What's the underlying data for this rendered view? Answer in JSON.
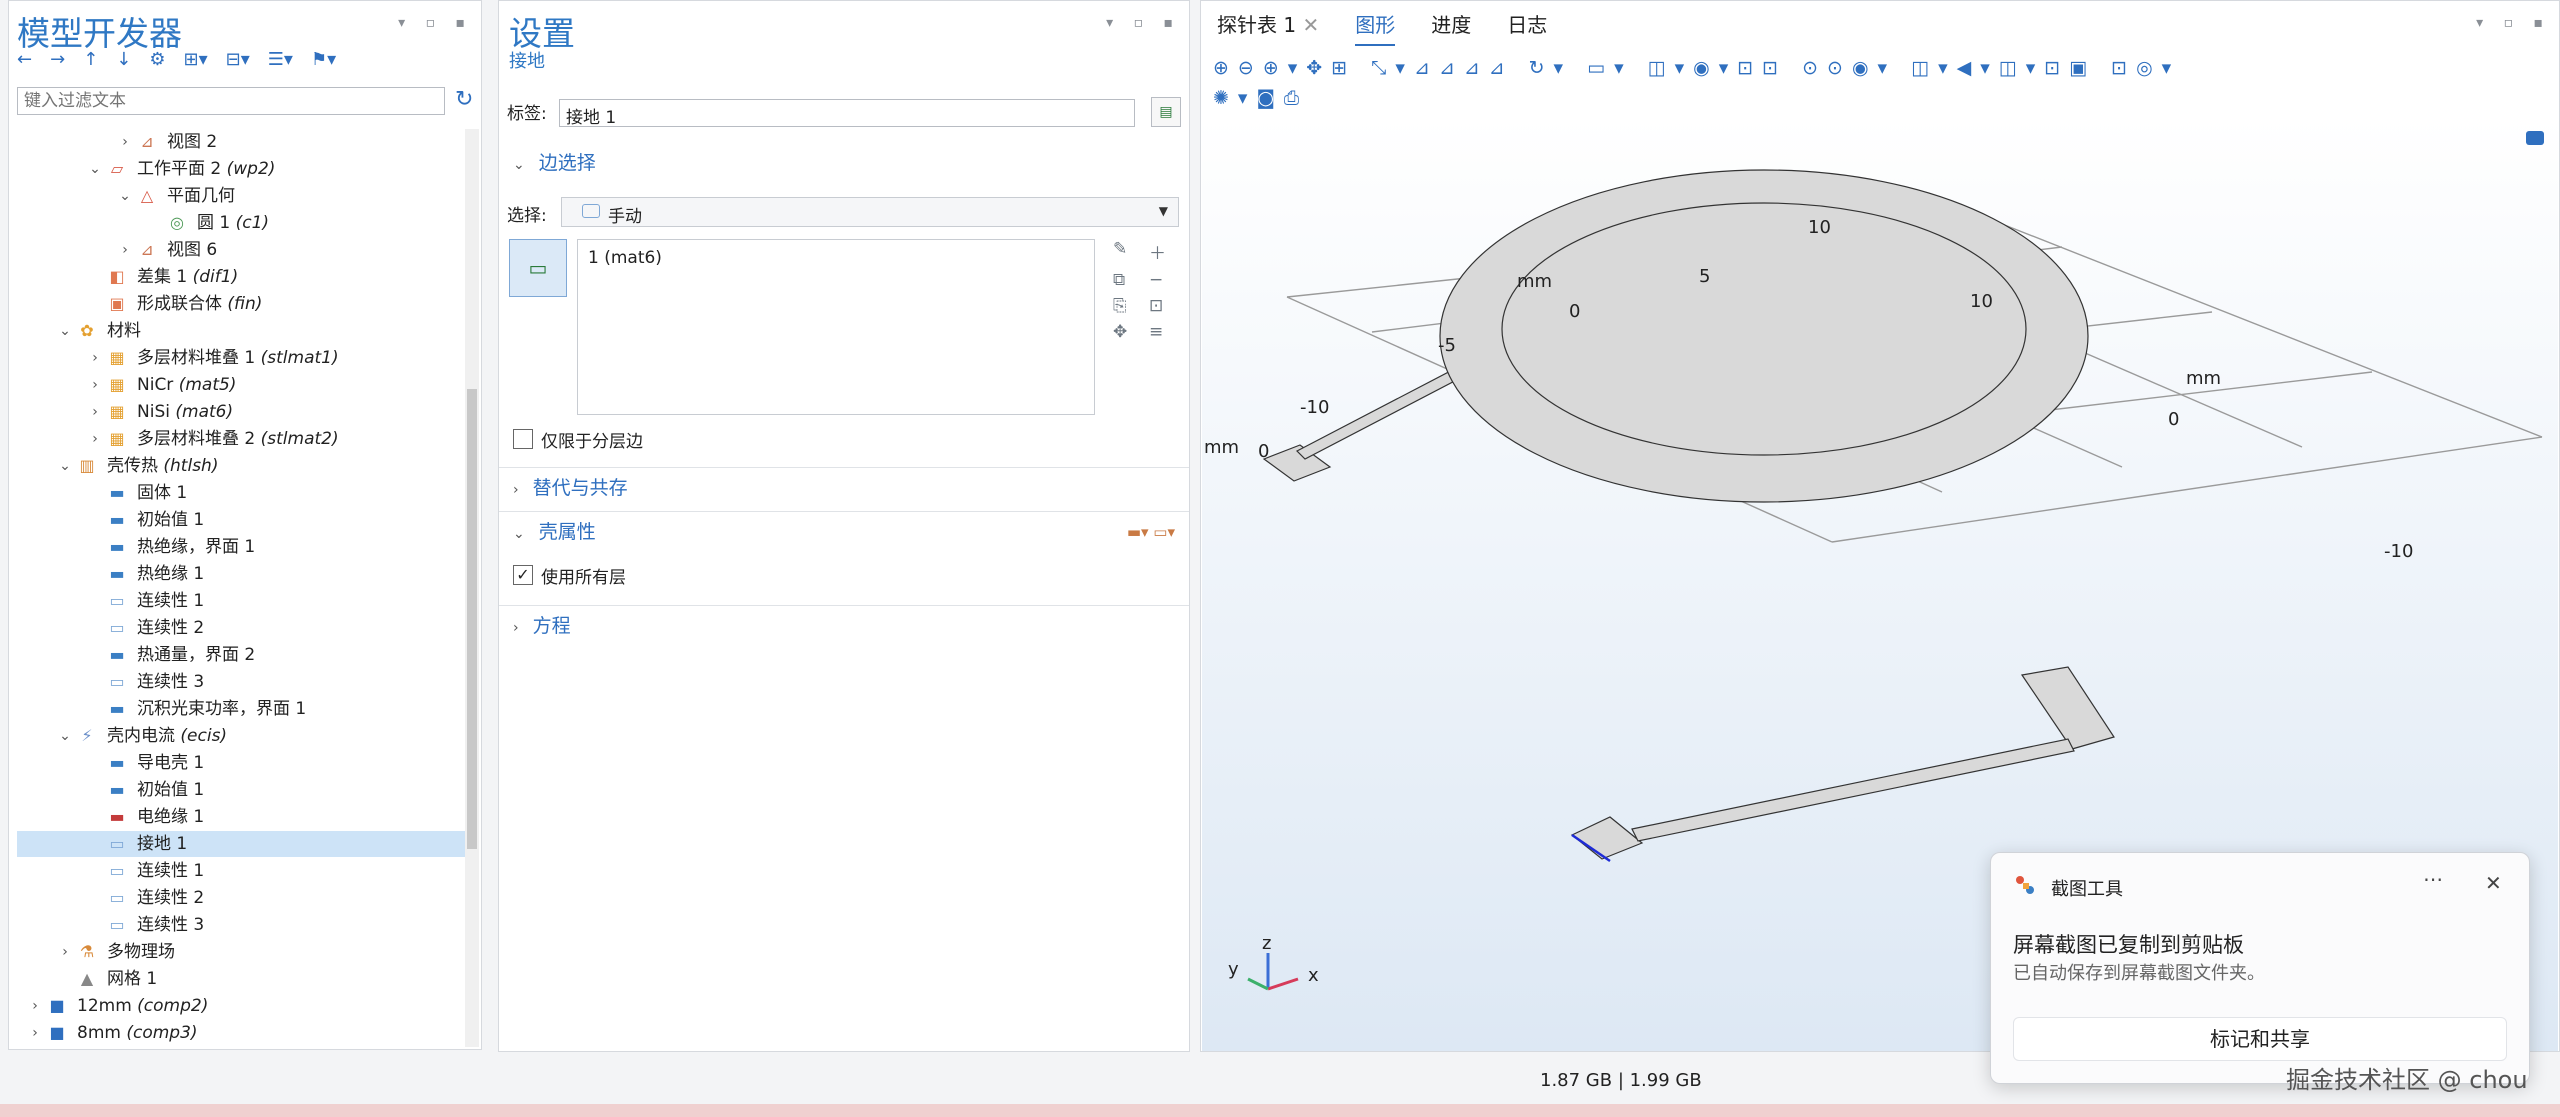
{
  "left_panel": {
    "title": "模型开发器",
    "filter_placeholder": "键入过滤文本",
    "toolbar_icons": [
      "back-arrow-icon",
      "forward-arrow-icon",
      "up-arrow-icon",
      "down-arrow-icon",
      "settings-icon",
      "expand-icon",
      "collapse-icon",
      "list-icon",
      "pin-icon"
    ],
    "tree": [
      {
        "level": 4,
        "chev": "›",
        "label": "视图 2",
        "tag": "",
        "icon": "view-icon",
        "color": "#cc7755"
      },
      {
        "level": 3,
        "chev": "⌄",
        "label": "工作平面 2",
        "tag": "(wp2)",
        "icon": "workplane-icon",
        "color": "#d85c4a"
      },
      {
        "level": 4,
        "chev": "⌄",
        "label": "平面几何",
        "tag": "",
        "icon": "plane-geometry-icon",
        "color": "#d85c4a"
      },
      {
        "level": 5,
        "chev": "",
        "label": "圆 1",
        "tag": "(c1)",
        "icon": "circle-icon",
        "color": "#4f9a58"
      },
      {
        "level": 4,
        "chev": "›",
        "label": "视图 6",
        "tag": "",
        "icon": "view-icon",
        "color": "#cc7755"
      },
      {
        "level": 3,
        "chev": "",
        "label": "差集 1",
        "tag": "(dif1)",
        "icon": "difference-icon",
        "color": "#e07850"
      },
      {
        "level": 3,
        "chev": "",
        "label": "形成联合体",
        "tag": "(fin)",
        "icon": "union-icon",
        "color": "#e07850"
      },
      {
        "level": 2,
        "chev": "⌄",
        "label": "材料",
        "tag": "",
        "icon": "material-icon",
        "color": "#e4a030"
      },
      {
        "level": 3,
        "chev": "›",
        "label": "多层材料堆叠 1",
        "tag": "(stlmat1)",
        "icon": "material-stack-icon",
        "color": "#e4a030"
      },
      {
        "level": 3,
        "chev": "›",
        "label": "NiCr",
        "tag": "(mat5)",
        "icon": "material-stack-icon",
        "color": "#e4a030"
      },
      {
        "level": 3,
        "chev": "›",
        "label": "NiSi",
        "tag": "(mat6)",
        "icon": "material-stack-icon",
        "color": "#e4a030"
      },
      {
        "level": 3,
        "chev": "›",
        "label": "多层材料堆叠 2",
        "tag": "(stlmat2)",
        "icon": "material-stack-icon",
        "color": "#e4a030"
      },
      {
        "level": 2,
        "chev": "⌄",
        "label": "壳传热",
        "tag": "(htlsh)",
        "icon": "shell-heat-icon",
        "color": "#d88a3a"
      },
      {
        "level": 3,
        "chev": "",
        "label": "固体 1",
        "tag": "",
        "icon": "solid-icon",
        "color": "#3b7fc4"
      },
      {
        "level": 3,
        "chev": "",
        "label": "初始值 1",
        "tag": "",
        "icon": "initial-value-icon",
        "color": "#3b7fc4"
      },
      {
        "level": 3,
        "chev": "",
        "label": "热绝缘，界面 1",
        "tag": "",
        "icon": "insulation-icon",
        "color": "#3b7fc4"
      },
      {
        "level": 3,
        "chev": "",
        "label": "热绝缘 1",
        "tag": "",
        "icon": "insulation-icon",
        "color": "#3b7fc4"
      },
      {
        "level": 3,
        "chev": "",
        "label": "连续性 1",
        "tag": "",
        "icon": "continuity-icon",
        "color": "#7fa8d6"
      },
      {
        "level": 3,
        "chev": "",
        "label": "连续性 2",
        "tag": "",
        "icon": "continuity-icon",
        "color": "#7fa8d6"
      },
      {
        "level": 3,
        "chev": "",
        "label": "热通量，界面 2",
        "tag": "",
        "icon": "heat-flux-icon",
        "color": "#3b7fc4"
      },
      {
        "level": 3,
        "chev": "",
        "label": "连续性 3",
        "tag": "",
        "icon": "continuity-icon",
        "color": "#7fa8d6"
      },
      {
        "level": 3,
        "chev": "",
        "label": "沉积光束功率，界面 1",
        "tag": "",
        "icon": "beam-power-icon",
        "color": "#3b7fc4"
      },
      {
        "level": 2,
        "chev": "⌄",
        "label": "壳内电流",
        "tag": "(ecis)",
        "icon": "shell-current-icon",
        "color": "#6b8fc9"
      },
      {
        "level": 3,
        "chev": "",
        "label": "导电壳 1",
        "tag": "",
        "icon": "conductive-shell-icon",
        "color": "#3b7fc4"
      },
      {
        "level": 3,
        "chev": "",
        "label": "初始值 1",
        "tag": "",
        "icon": "initial-value-icon",
        "color": "#3b7fc4"
      },
      {
        "level": 3,
        "chev": "",
        "label": "电绝缘 1",
        "tag": "",
        "icon": "electric-insulation-icon",
        "color": "#c43b3b"
      },
      {
        "level": 3,
        "chev": "",
        "label": "接地 1",
        "tag": "",
        "icon": "ground-icon",
        "color": "#7fa8d6",
        "selected": true
      },
      {
        "level": 3,
        "chev": "",
        "label": "连续性 1",
        "tag": "",
        "icon": "continuity-icon",
        "color": "#7fa8d6"
      },
      {
        "level": 3,
        "chev": "",
        "label": "连续性 2",
        "tag": "",
        "icon": "continuity-icon",
        "color": "#7fa8d6"
      },
      {
        "level": 3,
        "chev": "",
        "label": "连续性 3",
        "tag": "",
        "icon": "continuity-icon",
        "color": "#7fa8d6"
      },
      {
        "level": 2,
        "chev": "›",
        "label": "多物理场",
        "tag": "",
        "icon": "multiphysics-icon",
        "color": "#d88a3a"
      },
      {
        "level": 2,
        "chev": "",
        "label": "网格 1",
        "tag": "",
        "icon": "mesh-icon",
        "color": "#888888"
      },
      {
        "level": 1,
        "chev": "›",
        "label": "12mm",
        "tag": "(comp2)",
        "icon": "component-icon",
        "color": "#2f6fbf"
      },
      {
        "level": 1,
        "chev": "›",
        "label": "8mm",
        "tag": "(comp3)",
        "icon": "component-icon",
        "color": "#2f6fbf"
      }
    ]
  },
  "settings": {
    "title": "设置",
    "subtitle": "接地",
    "label_caption": "标签:",
    "label_value": "接地 1",
    "edge_section": "边选择",
    "select_caption": "选择:",
    "select_value": "手动",
    "list_item": "1 (mat6)",
    "only_layer_edges": "仅限于分层边",
    "override_section": "替代与共存",
    "shell_section": "壳属性",
    "use_all_layers": "使用所有层",
    "equation_section": "方程"
  },
  "graphics": {
    "tabs": [
      "探针表 1",
      "图形",
      "进度",
      "日志"
    ],
    "active_tab": "图形",
    "axis_labels": {
      "y_unit": "mm",
      "x_unit": "mm",
      "left_unit": "mm",
      "y_ticks": [
        "10",
        "5",
        "0",
        "-5",
        "-10"
      ],
      "x_ticks": [
        "10",
        "0",
        "-10"
      ],
      "z_tick": "0"
    },
    "triad": {
      "x": "x",
      "y": "y",
      "z": "z"
    }
  },
  "status": {
    "memory": "1.87 GB | 1.99 GB"
  },
  "toast": {
    "app": "截图工具",
    "title": "屏幕截图已复制到剪贴板",
    "desc": "已自动保存到屏幕截图文件夹。",
    "action": "标记和共享"
  },
  "watermark": "掘金技术社区 @ chou"
}
